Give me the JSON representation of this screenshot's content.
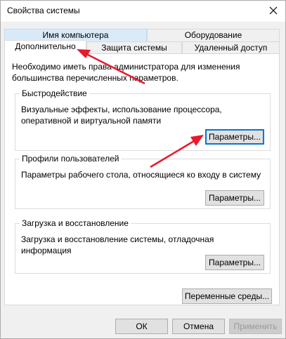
{
  "window": {
    "title": "Свойства системы",
    "close_icon": "close-icon"
  },
  "tabs": {
    "row1": [
      {
        "label": "Имя компьютера"
      },
      {
        "label": "Оборудование"
      }
    ],
    "row2": [
      {
        "label": "Дополнительно",
        "active": true
      },
      {
        "label": "Защита системы"
      },
      {
        "label": "Удаленный доступ"
      }
    ]
  },
  "advanced": {
    "note": "Необходимо иметь права администратора для изменения большинства перечисленных параметров.",
    "performance": {
      "title": "Быстродействие",
      "description": "Визуальные эффекты, использование процессора, оперативной и виртуальной памяти",
      "button": "Параметры..."
    },
    "profiles": {
      "title": "Профили пользователей",
      "description": "Параметры рабочего стола, относящиеся ко входу в систему",
      "button": "Параметры..."
    },
    "startup": {
      "title": "Загрузка и восстановление",
      "description": "Загрузка и восстановление системы, отладочная информация",
      "button": "Параметры..."
    },
    "env_button": "Переменные среды..."
  },
  "footer": {
    "ok": "ОК",
    "cancel": "Отмена",
    "apply": "Применить"
  },
  "colors": {
    "annotation_arrow": "#e8192c",
    "focus_border": "#0078d7"
  }
}
